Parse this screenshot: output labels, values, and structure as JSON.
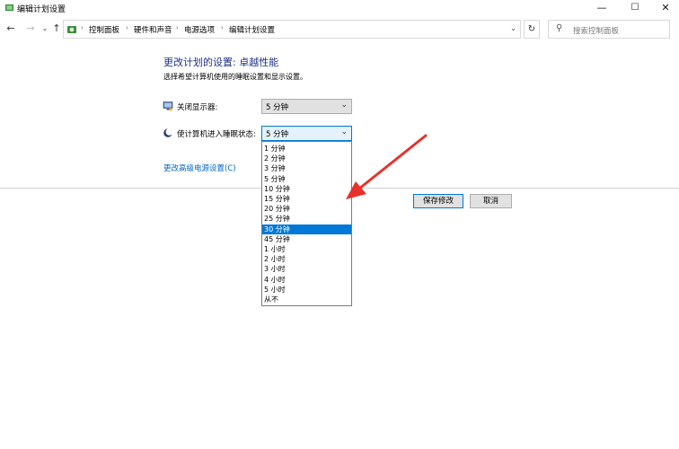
{
  "window": {
    "title": "编辑计划设置",
    "minimize_glyph": "—",
    "maximize_glyph": "☐",
    "close_glyph": "✕"
  },
  "nav": {
    "back_glyph": "←",
    "forward_glyph": "→",
    "recent_glyph": "⌄",
    "up_glyph": "↑",
    "refresh_glyph": "↻",
    "breadcrumb": [
      "控制面板",
      "硬件和声音",
      "电源选项",
      "编辑计划设置"
    ],
    "breadcrumb_sep": "›",
    "address_dropdown_glyph": "⌄",
    "search_icon_glyph": "⚲",
    "search_placeholder": "搜索控制面板"
  },
  "main": {
    "heading": "更改计划的设置: 卓越性能",
    "subtext": "选择希望计算机使用的睡眠设置和显示设置。",
    "display_off": {
      "label": "关闭显示器:",
      "value": "5 分钟",
      "icon": "monitor-icon"
    },
    "sleep": {
      "label": "使计算机进入睡眠状态:",
      "value": "5 分钟",
      "icon": "moon-icon"
    },
    "dropdown_arrow": "⌄",
    "advanced_link": "更改高级电源设置(C)",
    "save_button": "保存修改",
    "cancel_button": "取消"
  },
  "sleep_options": [
    "1 分钟",
    "2 分钟",
    "3 分钟",
    "5 分钟",
    "10 分钟",
    "15 分钟",
    "20 分钟",
    "25 分钟",
    "30 分钟",
    "45 分钟",
    "1 小时",
    "2 小时",
    "3 小时",
    "4 小时",
    "5 小时",
    "从不"
  ],
  "highlighted_option_index": 8,
  "colors": {
    "accent": "#0078d7",
    "heading": "#1e3287",
    "link": "#0066cc",
    "annotation_arrow": "#e8312b"
  }
}
